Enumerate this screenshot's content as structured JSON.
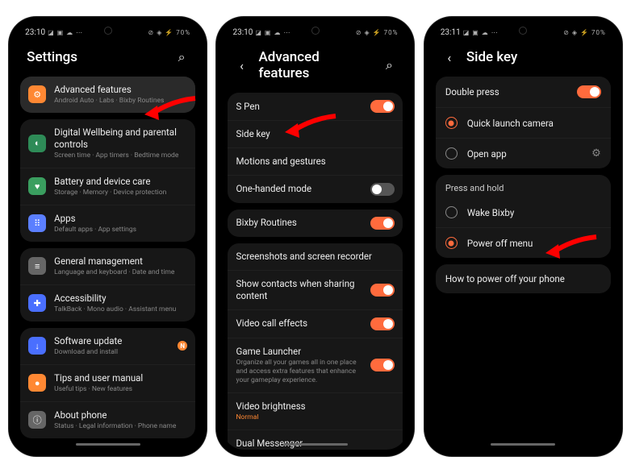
{
  "status": {
    "time1": "23:10",
    "time2": "23:10",
    "time3": "23:11",
    "left_icons": "◪ ▣ ☁ ⋯",
    "right_icons": "⊘ ◈ ⚡ 70%",
    "battery": "70%"
  },
  "screen1": {
    "title": "Settings",
    "items": [
      {
        "title": "Advanced features",
        "sub": "Android Auto · Labs · Bixby Routines",
        "color": "#ff8833",
        "glyph": "⚙"
      },
      {
        "title": "Digital Wellbeing and parental controls",
        "sub": "Screen time · App timers · Bedtime mode",
        "color": "#2e8b57",
        "glyph": "◐"
      },
      {
        "title": "Battery and device care",
        "sub": "Storage · Memory · Device protection",
        "color": "#3a9e5f",
        "glyph": "♥"
      },
      {
        "title": "Apps",
        "sub": "Default apps · App settings",
        "color": "#5b7fff",
        "glyph": "⠿"
      },
      {
        "title": "General management",
        "sub": "Language and keyboard · Date and time",
        "color": "#666",
        "glyph": "≡"
      },
      {
        "title": "Accessibility",
        "sub": "TalkBack · Mono audio · Assistant menu",
        "color": "#4a6fff",
        "glyph": "✚"
      },
      {
        "title": "Software update",
        "sub": "Download and install",
        "color": "#4a6fff",
        "glyph": "↓",
        "badge": "N"
      },
      {
        "title": "Tips and user manual",
        "sub": "Useful tips · New features",
        "color": "#ff8833",
        "glyph": "●"
      },
      {
        "title": "About phone",
        "sub": "Status · Legal information · Phone name",
        "color": "#666",
        "glyph": "ⓘ"
      }
    ]
  },
  "screen2": {
    "title": "Advanced features",
    "groups": [
      [
        {
          "title": "S Pen",
          "toggle": true
        },
        {
          "title": "Side key"
        },
        {
          "title": "Motions and gestures"
        },
        {
          "title": "One-handed mode",
          "toggle": false
        }
      ],
      [
        {
          "title": "Bixby Routines",
          "toggle": true
        }
      ],
      [
        {
          "title": "Screenshots and screen recorder"
        },
        {
          "title": "Show contacts when sharing content",
          "toggle": true
        },
        {
          "title": "Video call effects",
          "toggle": true
        },
        {
          "title": "Game Launcher",
          "sub": "Organize all your games all in one place and access extra features that enhance your gameplay experience.",
          "toggle": true
        },
        {
          "title": "Video brightness",
          "sub": "Normal",
          "subOrange": true
        },
        {
          "title": "Dual Messenger"
        }
      ]
    ]
  },
  "screen3": {
    "title": "Side key",
    "sections": [
      {
        "header": "Double press",
        "headerToggle": true,
        "options": [
          {
            "label": "Quick launch camera",
            "selected": true
          },
          {
            "label": "Open app",
            "selected": false,
            "gear": true
          }
        ]
      },
      {
        "header": "Press and hold",
        "options": [
          {
            "label": "Wake Bixby",
            "selected": false
          },
          {
            "label": "Power off menu",
            "selected": true
          }
        ]
      }
    ],
    "footer": "How to power off your phone"
  }
}
